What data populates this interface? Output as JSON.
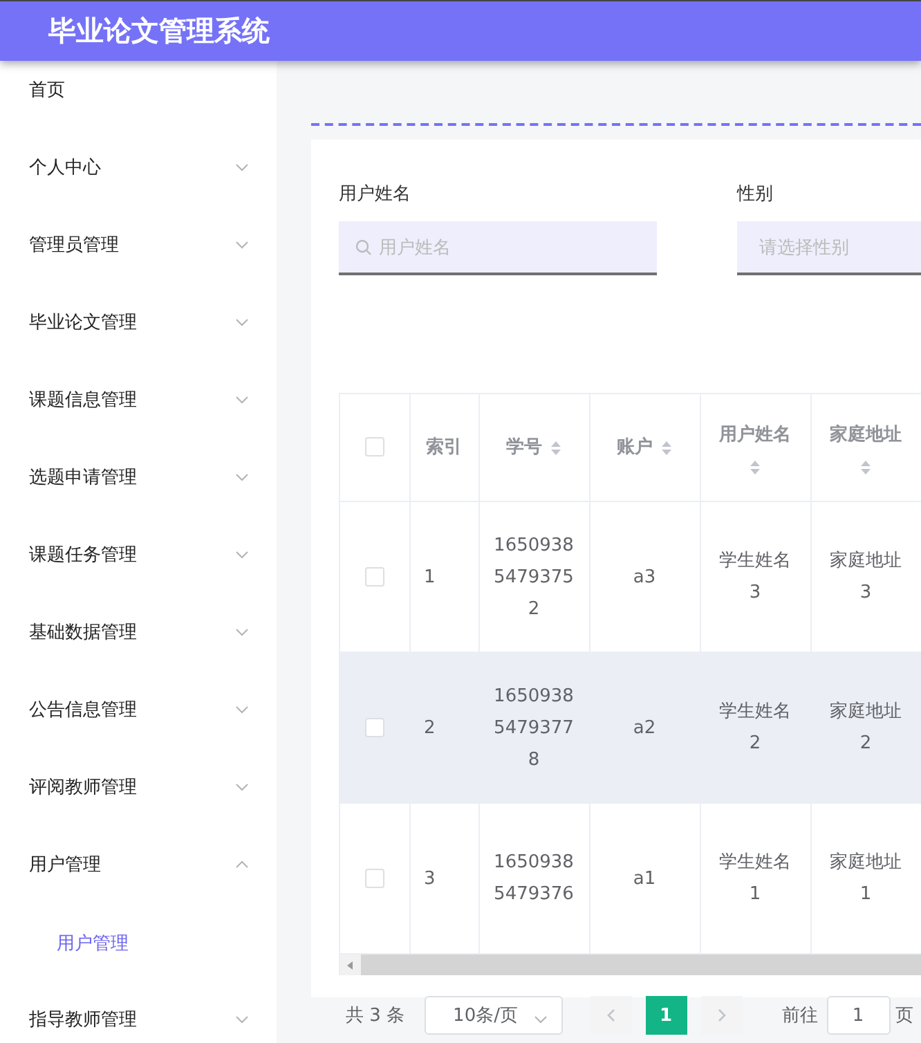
{
  "header": {
    "title": "毕业论文管理系统"
  },
  "sidebar": {
    "items": [
      {
        "label": "首页",
        "expandable": false
      },
      {
        "label": "个人中心",
        "expandable": true,
        "expanded": false
      },
      {
        "label": "管理员管理",
        "expandable": true,
        "expanded": false
      },
      {
        "label": "毕业论文管理",
        "expandable": true,
        "expanded": false
      },
      {
        "label": "课题信息管理",
        "expandable": true,
        "expanded": false
      },
      {
        "label": "选题申请管理",
        "expandable": true,
        "expanded": false
      },
      {
        "label": "课题任务管理",
        "expandable": true,
        "expanded": false
      },
      {
        "label": "基础数据管理",
        "expandable": true,
        "expanded": false
      },
      {
        "label": "公告信息管理",
        "expandable": true,
        "expanded": false
      },
      {
        "label": "评阅教师管理",
        "expandable": true,
        "expanded": false
      },
      {
        "label": "用户管理",
        "expandable": true,
        "expanded": true,
        "children": [
          {
            "label": "用户管理",
            "selected": true
          }
        ]
      },
      {
        "label": "指导教师管理",
        "expandable": true,
        "expanded": false
      }
    ]
  },
  "search": {
    "fields": [
      {
        "label": "用户姓名",
        "kind": "text",
        "placeholder": "用户姓名"
      },
      {
        "label": "性别",
        "kind": "select",
        "placeholder": "请选择性别"
      }
    ]
  },
  "table": {
    "header_checked": false,
    "columns": [
      {
        "label": "索引",
        "sortable": false
      },
      {
        "label": "学号",
        "sortable": true
      },
      {
        "label": "账户",
        "sortable": true
      },
      {
        "label": "用户姓名",
        "sortable": true
      },
      {
        "label": "家庭地址",
        "sortable": true
      }
    ],
    "rows": [
      {
        "checked": false,
        "hovered": false,
        "cells": [
          "1",
          "16509385479375 2",
          "a3",
          "学生姓名3",
          "家庭地址3"
        ]
      },
      {
        "checked": false,
        "hovered": true,
        "cells": [
          "2",
          "16509385479377 8",
          "a2",
          "学生姓名2",
          "家庭地址2"
        ]
      },
      {
        "checked": false,
        "hovered": false,
        "cells": [
          "3",
          "16509385479376",
          "a1",
          "学生姓名1",
          "家庭地址1"
        ]
      }
    ]
  },
  "pagination": {
    "total": "共 3 条",
    "page_size": "10条/页",
    "pages": [
      {
        "label": "1",
        "selected": true
      }
    ],
    "goto_label": "前往",
    "goto_value": "1",
    "goto_suffix": "页"
  }
}
